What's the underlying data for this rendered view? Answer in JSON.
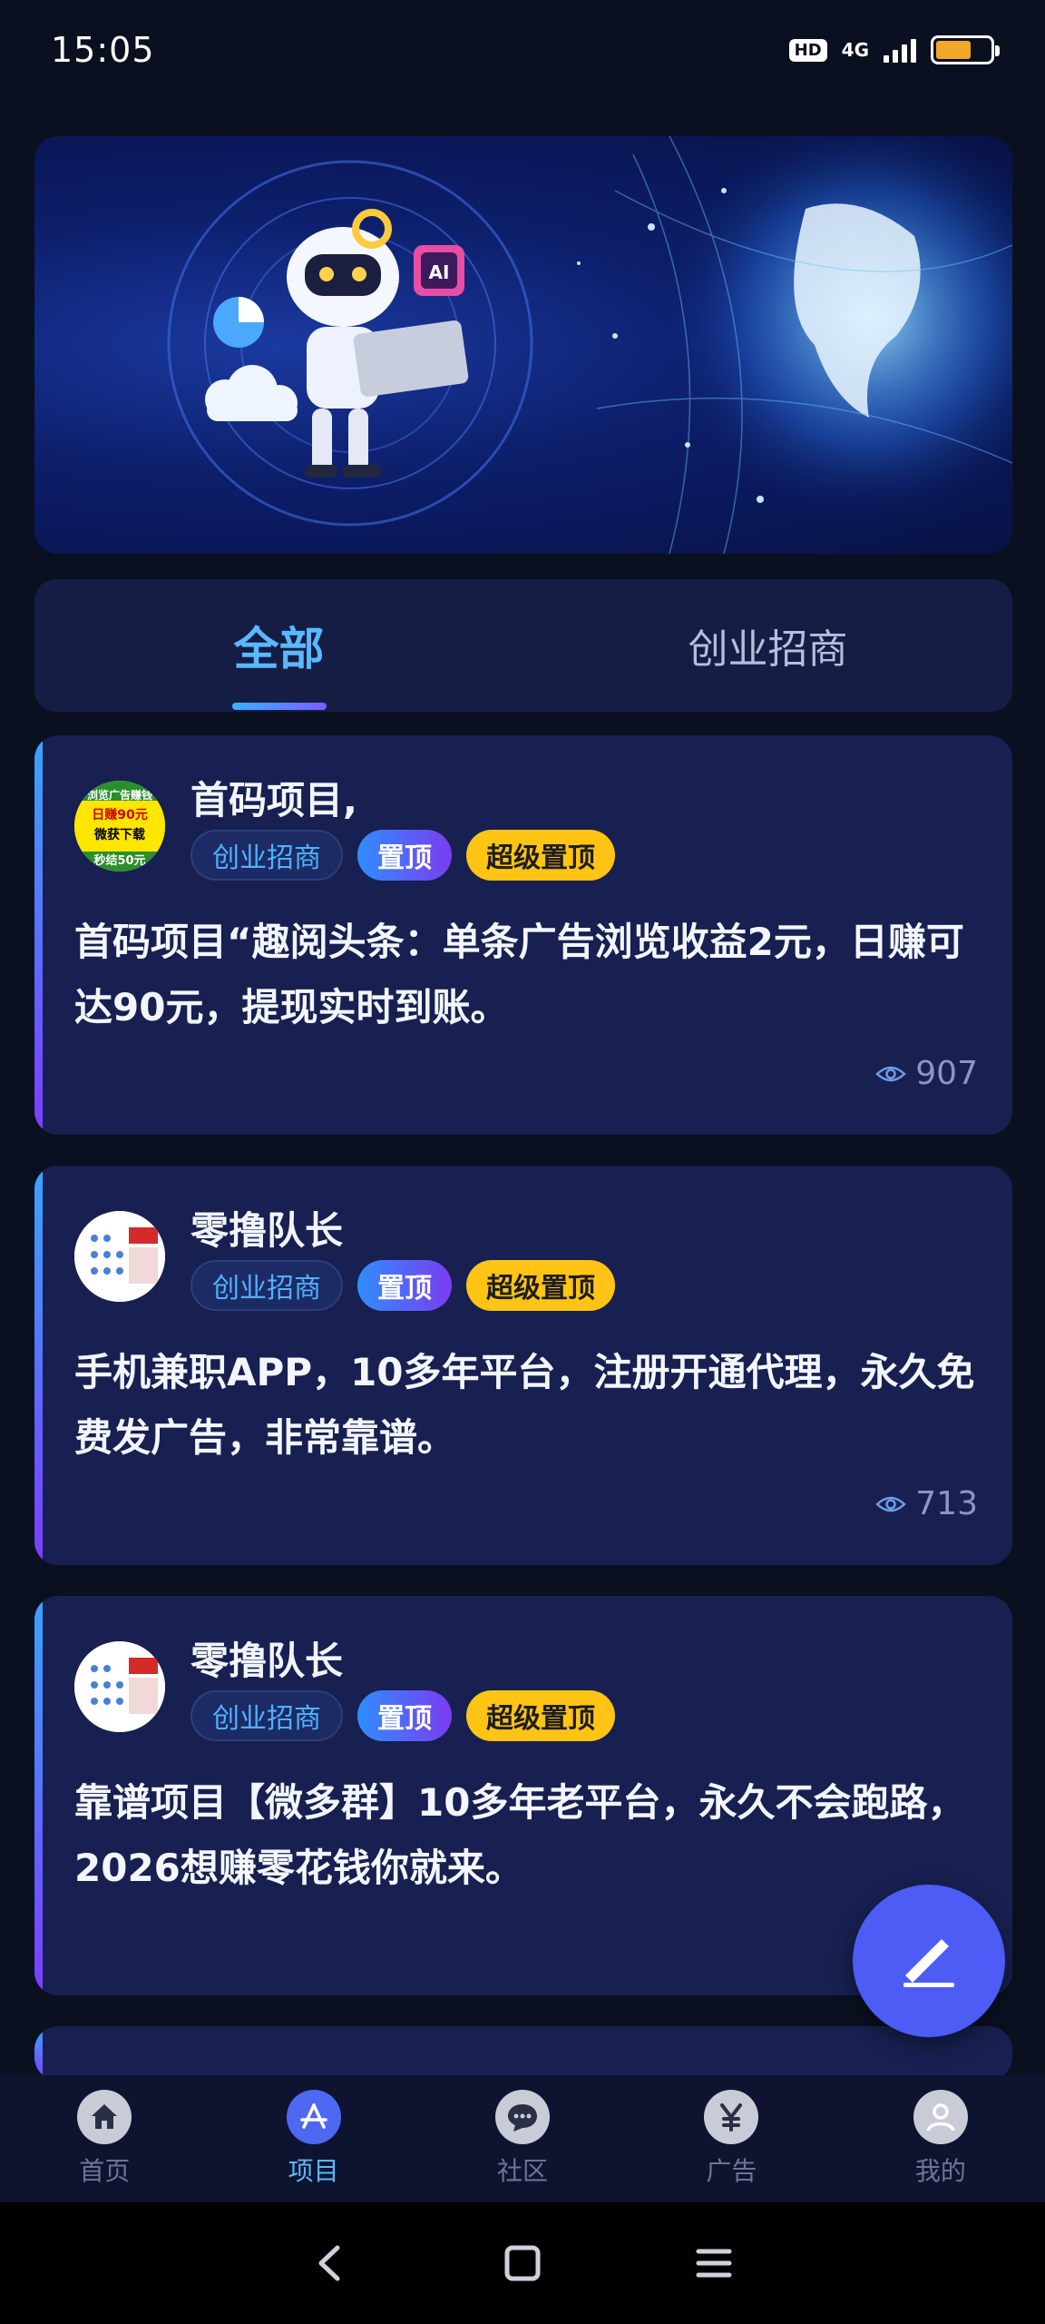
{
  "status_bar": {
    "time": "15:05",
    "hd_label": "HD",
    "network_label": "4G",
    "battery_level": 0.65,
    "battery_color": "#f0a928"
  },
  "banner": {
    "chip_label": "AI"
  },
  "tabs": [
    {
      "label": "全部",
      "active": true
    },
    {
      "label": "创业招商",
      "active": false
    }
  ],
  "posts": [
    {
      "author": "首码项目,",
      "tags": [
        "创业招商",
        "置顶",
        "超级置顶"
      ],
      "body": "首码项目“趣阅头条：单条广告浏览收益2元，日赚可达90元，提现实时到账。",
      "views": "907",
      "avatar_lines": [
        "浏览广告赚钱",
        "日赚90元",
        "微获下载",
        "秒结50元"
      ]
    },
    {
      "author": "零撸队长",
      "tags": [
        "创业招商",
        "置顶",
        "超级置顶"
      ],
      "body": "手机兼职APP，10多年平台，注册开通代理，永久免费发广告，非常靠谱。",
      "views": "713"
    },
    {
      "author": "零撸队长",
      "tags": [
        "创业招商",
        "置顶",
        "超级置顶"
      ],
      "body": "靠谱项目【微多群】10多年老平台，永久不会跑路，2026想赚零花钱你就来。",
      "views": ""
    }
  ],
  "bottom_nav": [
    {
      "label": "首页",
      "icon": "home-icon",
      "active": false
    },
    {
      "label": "项目",
      "icon": "app-store-icon",
      "active": true
    },
    {
      "label": "社区",
      "icon": "chat-bubble-icon",
      "active": false
    },
    {
      "label": "广告",
      "icon": "yen-icon",
      "active": false
    },
    {
      "label": "我的",
      "icon": "user-icon",
      "active": false
    }
  ],
  "colors": {
    "accent": "#5ab8ff",
    "card_bg": "#172050",
    "fab": "#4d5cf5",
    "tag_super": "#ffc414"
  }
}
